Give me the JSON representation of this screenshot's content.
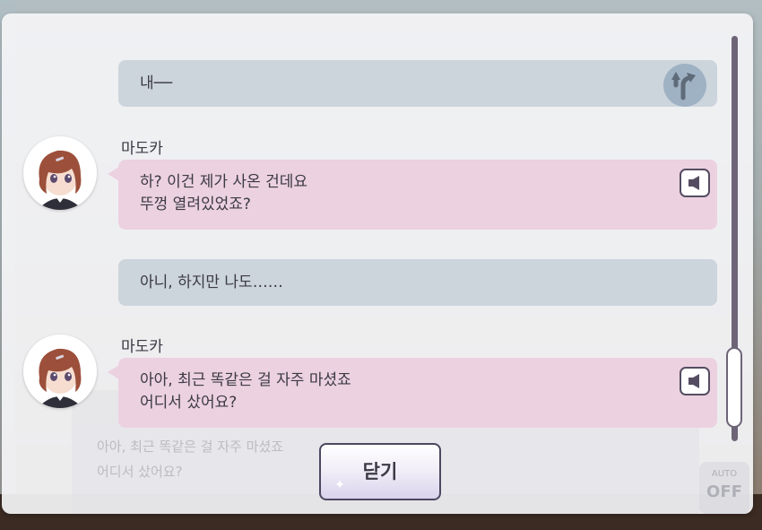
{
  "log": {
    "entries": [
      {
        "type": "player",
        "text": "내──",
        "icon": "choice-branch-icon"
      },
      {
        "type": "npc",
        "speaker": "마도카",
        "text": "하? 이건 제가 사온 건데요\n뚜껑 열려있었죠?",
        "icon": "voice-play-icon"
      },
      {
        "type": "player",
        "text": "아니, 하지만 나도……"
      },
      {
        "type": "npc",
        "speaker": "마도카",
        "text": "아아, 최근 똑같은 걸 자주 마셨죠\n어디서 샀어요?",
        "icon": "voice-play-icon"
      }
    ],
    "close_label": "닫기"
  },
  "background": {
    "dialogue_line1": "아아, 최근 똑같은 걸 자주 마셨죠",
    "dialogue_line2": "어디서 샀어요?",
    "auto_label": "AUTO",
    "auto_state": "OFF"
  },
  "colors": {
    "player_bubble": "#ccd4dc",
    "npc_bubble": "#ecd1e0",
    "text": "#3b3a45",
    "scrollbar": "#6e6478"
  }
}
